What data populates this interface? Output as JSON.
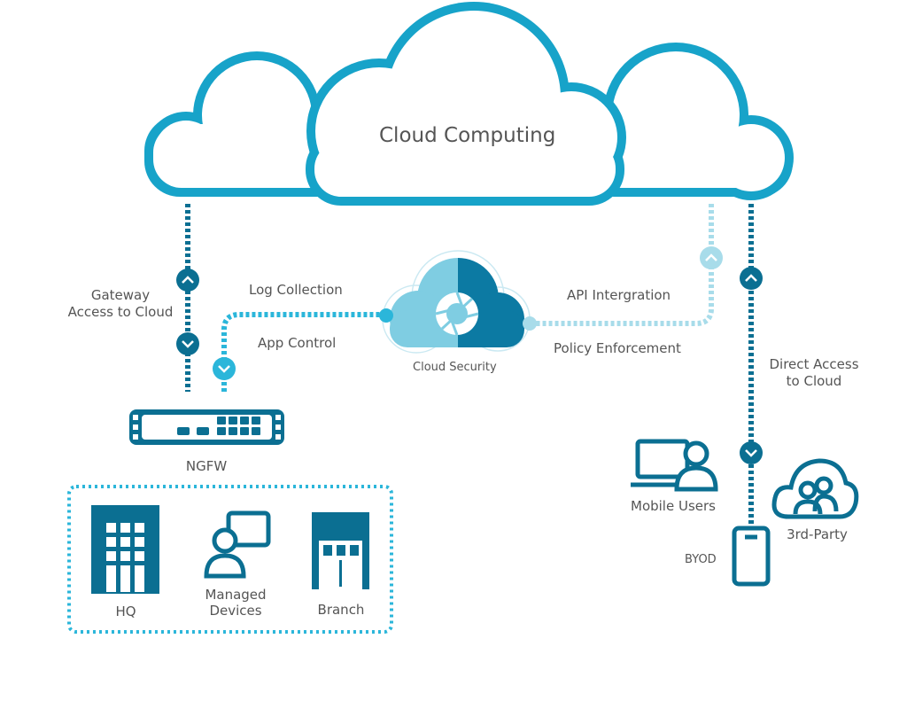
{
  "title": "Cloud Computing",
  "cloud_security": {
    "label": "Cloud Security"
  },
  "left_path": {
    "label_line1": "Gateway",
    "label_line2": "Access to Cloud"
  },
  "links": {
    "log_collection": "Log Collection",
    "app_control": "App Control",
    "api_integration": "API Intergration",
    "policy_enforcement": "Policy Enforcement"
  },
  "right_path": {
    "label_line1": "Direct Access",
    "label_line2": "to Cloud"
  },
  "ngfw": {
    "label": "NGFW"
  },
  "sites": [
    {
      "label": "HQ",
      "icon": "building-icon"
    },
    {
      "label_line1": "Managed",
      "label_line2": "Devices",
      "icon": "managed-device-icon"
    },
    {
      "label": "Branch",
      "icon": "store-icon"
    }
  ],
  "endpoints": {
    "mobile_users": "Mobile Users",
    "byod": "BYOD",
    "third_party": "3rd-Party"
  },
  "colors": {
    "cloud_outline": "#17a3c9",
    "dark": "#0b6f92",
    "medium": "#2bb6da",
    "light": "#a8dcea",
    "text": "#555555"
  }
}
